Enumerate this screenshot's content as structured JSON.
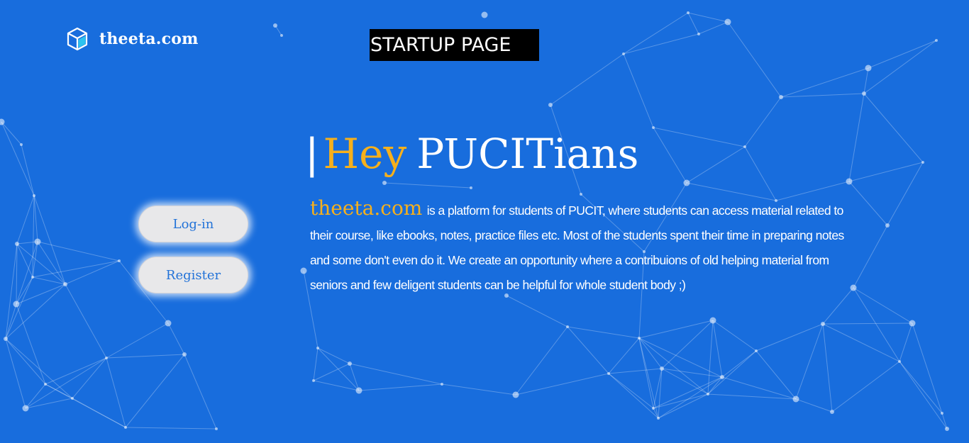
{
  "header": {
    "logo_icon": "cube-icon",
    "logo_text": "theeta.com",
    "badge_text": "STARTUP PAGE"
  },
  "hero": {
    "cursor": "|",
    "greeting": "Hey",
    "audience": "PUCITians"
  },
  "description": {
    "brand": "theeta.com",
    "text": "is a platform for students of PUCIT, where students can access material related to their course, like ebooks, notes, practice files etc. Most of the students spent their time in preparing notes and some don't even do it. We create an opportunity where a contribuions of old helping material from seniors and few deligent students can be helpful for whole student body ;)"
  },
  "actions": {
    "login_label": "Log-in",
    "register_label": "Register"
  },
  "colors": {
    "background": "#186ddd",
    "accent": "#f6b01c",
    "button_bg": "#e8e8ea",
    "button_text": "#2373d8"
  }
}
